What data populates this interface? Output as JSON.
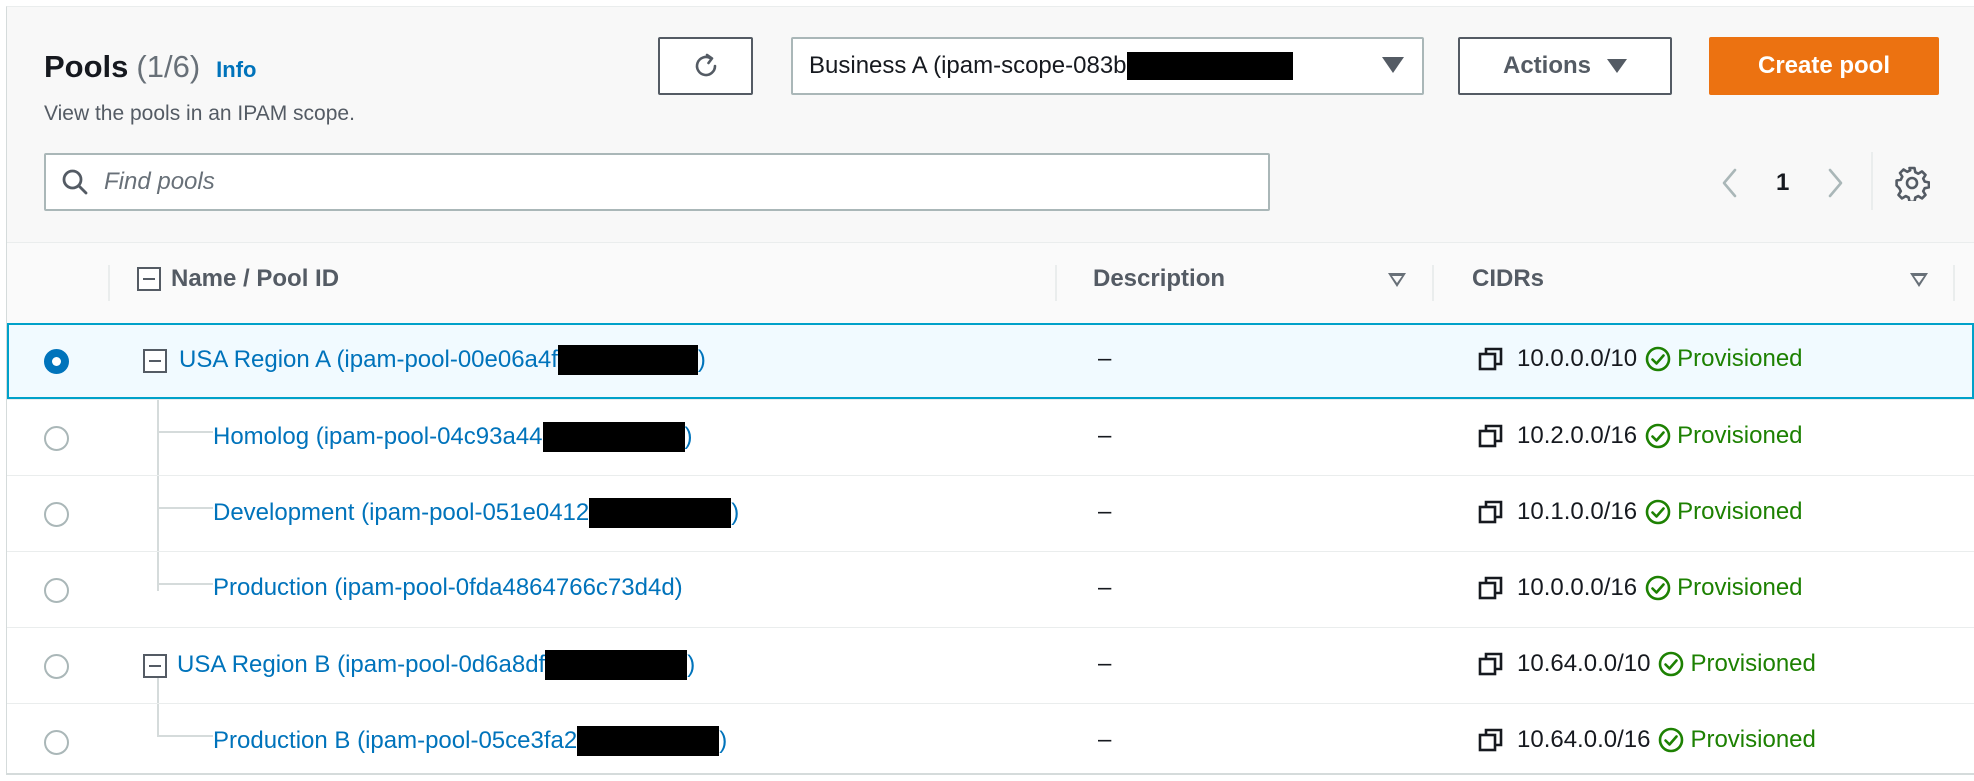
{
  "header": {
    "title": "Pools",
    "count": "(1/6)",
    "info_label": "Info",
    "subtitle": "View the pools in an IPAM scope.",
    "scope_value": "Business A (ipam-scope-083b",
    "actions_label": "Actions",
    "create_label": "Create pool"
  },
  "search": {
    "placeholder": "Find pools",
    "value": ""
  },
  "pagination": {
    "current_page": "1"
  },
  "table": {
    "columns": {
      "name": "Name / Pool ID",
      "description": "Description",
      "cidrs": "CIDRs"
    },
    "rows": [
      {
        "name": "USA Region A (ipam-pool-00e06a4f",
        "suffix": ")",
        "description": "–",
        "cidr": "10.0.0.0/10",
        "status": "Provisioned"
      },
      {
        "name": "Homolog (ipam-pool-04c93a44",
        "suffix": ")",
        "description": "–",
        "cidr": "10.2.0.0/16",
        "status": "Provisioned"
      },
      {
        "name": "Development (ipam-pool-051e0412",
        "suffix": ")",
        "description": "–",
        "cidr": "10.1.0.0/16",
        "status": "Provisioned"
      },
      {
        "name": "Production (ipam-pool-0fda4864766c73d4d)",
        "suffix": "",
        "description": "–",
        "cidr": "10.0.0.0/16",
        "status": "Provisioned"
      },
      {
        "name": "USA Region B (ipam-pool-0d6a8df",
        "suffix": ")",
        "description": "–",
        "cidr": "10.64.0.0/10",
        "status": "Provisioned"
      },
      {
        "name": "Production B (ipam-pool-05ce3fa2",
        "suffix": ")",
        "description": "–",
        "cidr": "10.64.0.0/16",
        "status": "Provisioned"
      }
    ]
  },
  "colors": {
    "accent": "#0073bb",
    "primary_button": "#ec7211",
    "success": "#1d8102",
    "selected_row_bg": "#f1faff",
    "selected_row_border": "#00a1c9"
  },
  "icons": {
    "refresh": "refresh-icon",
    "search": "search-icon",
    "prev": "chevron-left-icon",
    "next": "chevron-right-icon",
    "settings": "gear-icon",
    "copy": "copy-icon",
    "status": "check-circle-icon",
    "collapse": "collapse-icon"
  }
}
